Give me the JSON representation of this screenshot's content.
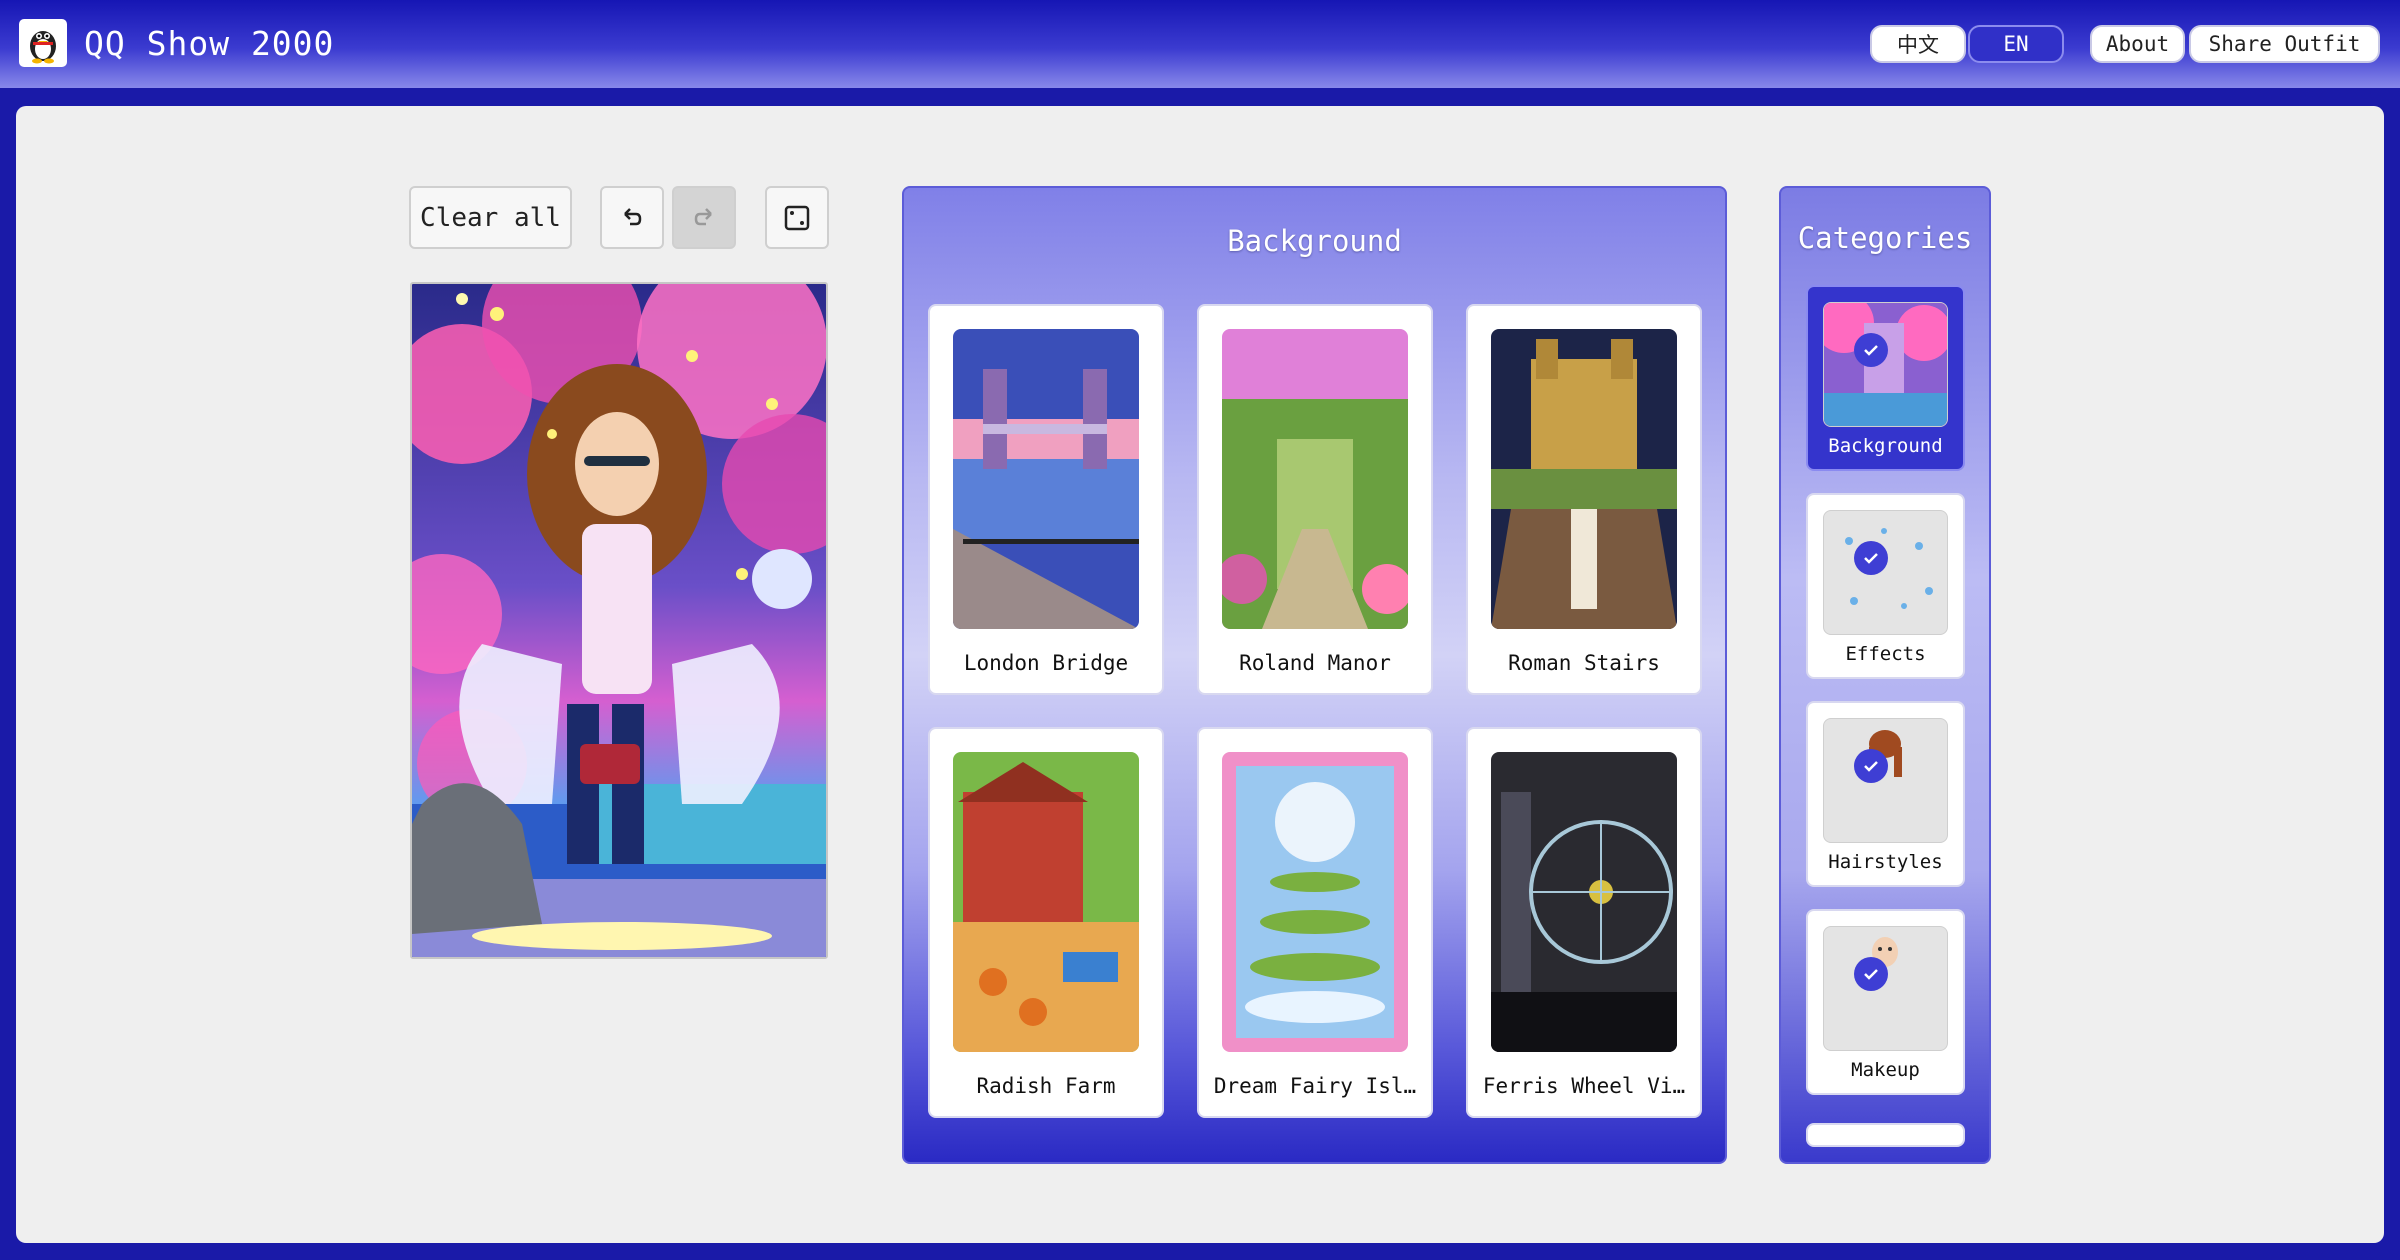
{
  "header": {
    "title": "QQ Show 2000",
    "lang_zh": "中文",
    "lang_en": "EN",
    "about": "About",
    "share": "Share Outfit"
  },
  "toolbar": {
    "clear_all": "Clear all",
    "undo_icon": "undo-icon",
    "redo_icon": "redo-icon",
    "random_icon": "dice-icon"
  },
  "background_panel": {
    "title": "Background",
    "items": [
      {
        "label": "London Bridge"
      },
      {
        "label": "Roland Manor"
      },
      {
        "label": "Roman Stairs"
      },
      {
        "label": "Radish Farm"
      },
      {
        "label": "Dream Fairy Isl…"
      },
      {
        "label": "Ferris Wheel Vi…"
      }
    ]
  },
  "categories": {
    "title": "Categories",
    "items": [
      {
        "label": "Background",
        "selected": true
      },
      {
        "label": "Effects",
        "selected": false
      },
      {
        "label": "Hairstyles",
        "selected": false
      },
      {
        "label": "Makeup",
        "selected": false
      }
    ]
  },
  "colors": {
    "header_blue": "#1616b4",
    "accent": "#3434cc",
    "panel_lavender": "#b8b8f2"
  }
}
